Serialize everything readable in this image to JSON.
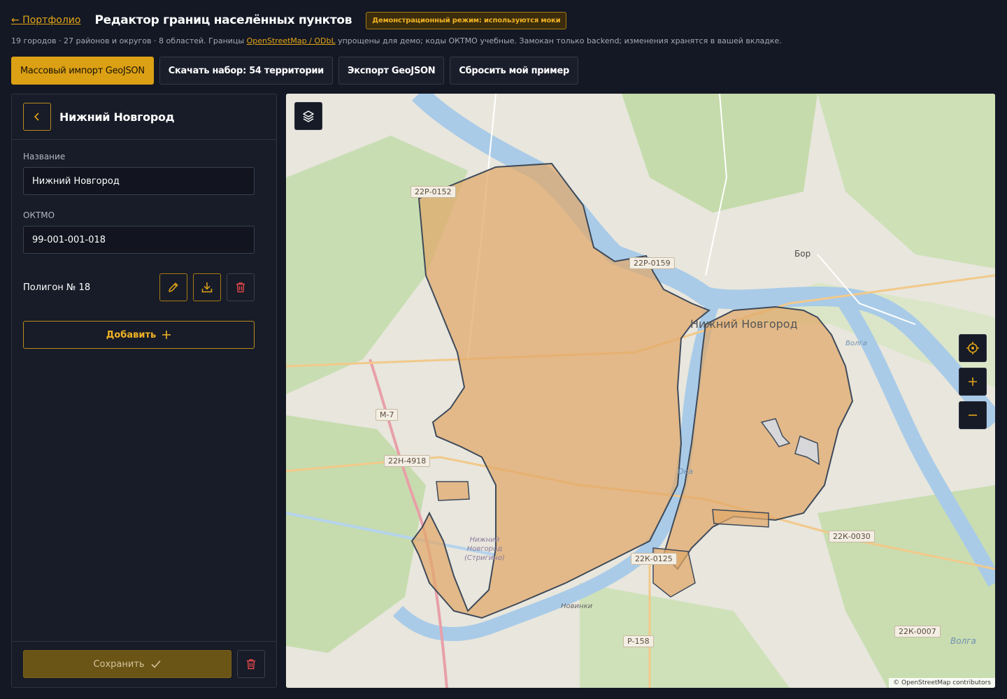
{
  "header": {
    "back_link": "← Портфолио",
    "title": "Редактор границ населённых пунктов",
    "demo_badge": "Демонстрационный режим: используются моки"
  },
  "subtitle": {
    "before": "19 городов · 27 районов и округов · 8 областей. Границы ",
    "link": "OpenStreetMap / ODbL",
    "after": " упрощены для демо; коды ОКТМО учебные. Замокан только backend; изменения хранятся в вашей вкладке."
  },
  "toolbar": {
    "import": "Массовый импорт GeoJSON",
    "download": "Скачать набор: 54 территории",
    "export": "Экспорт GeoJSON",
    "reset": "Сбросить мой пример"
  },
  "sidebar": {
    "title": "Нижний Новгород",
    "name_label": "Название",
    "name_value": "Нижний Новгород",
    "oktmo_label": "ОКТМО",
    "oktmo_value": "99-001-001-018",
    "polygon_label": "Полигон № 18",
    "add_label": "Добавить",
    "save_label": "Сохранить"
  },
  "map": {
    "city_label": "Нижний Новгород",
    "labels": {
      "bor": "Бор",
      "volga1": "Волга",
      "volga2": "Волга",
      "oka": "Ока",
      "novinki": "Новинки",
      "airport_1": "Нижний",
      "airport_2": "Новгород",
      "airport_3": "(Стригино)"
    },
    "roads": {
      "r1": "22Р-0152",
      "r2": "22Р-0159",
      "r3": "М-7",
      "r4": "22Н-4918",
      "r5": "22К-0125",
      "r6": "22К-0030",
      "r7": "22К-0007",
      "r8": "Р-158"
    },
    "attribution": "© OpenStreetMap contributors"
  },
  "colors": {
    "accent": "#dca014",
    "polygon_fill": "#e0a868",
    "polygon_stroke": "#3e4a5a",
    "water": "#a8c9e6",
    "forest": "#c4dcab"
  }
}
